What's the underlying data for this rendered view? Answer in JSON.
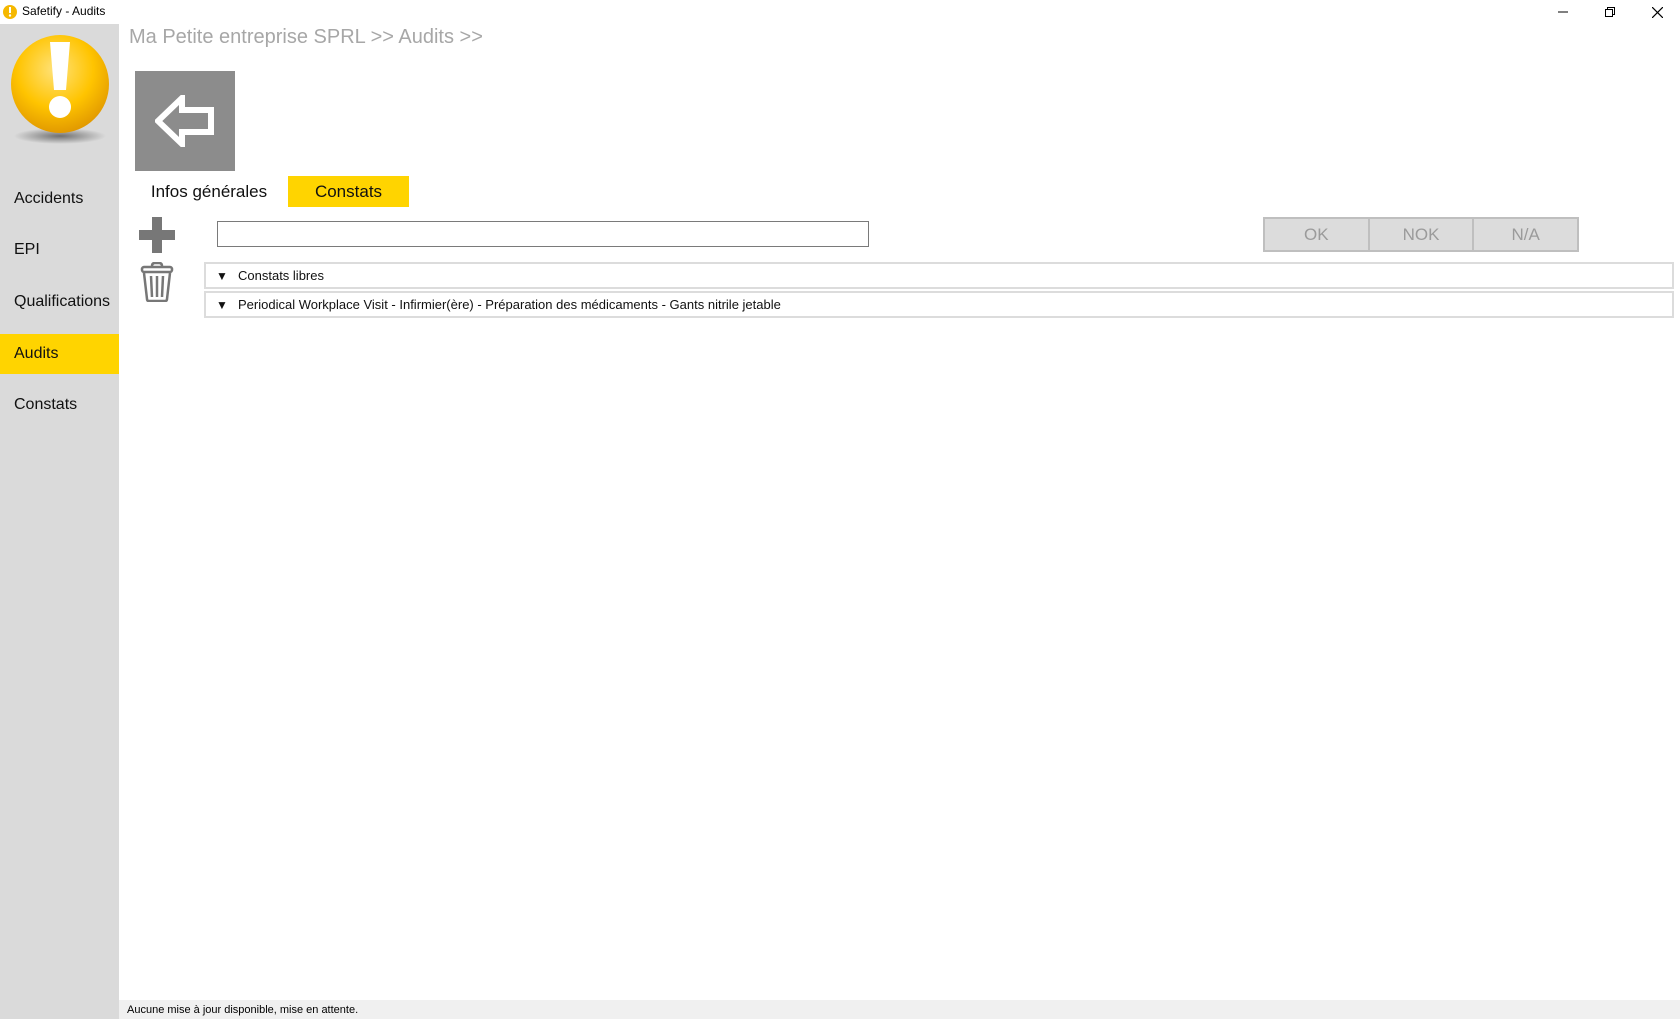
{
  "window": {
    "title": "Safetify - Audits"
  },
  "sidebar": {
    "items": [
      {
        "label": "Accidents",
        "active": false
      },
      {
        "label": "EPI",
        "active": false
      },
      {
        "label": "Qualifications",
        "active": false
      },
      {
        "label": "Audits",
        "active": true
      },
      {
        "label": "Constats",
        "active": false
      }
    ]
  },
  "breadcrumb": "Ma Petite entreprise SPRL >> Audits >>",
  "tabs": [
    {
      "label": "Infos générales",
      "active": false
    },
    {
      "label": "Constats",
      "active": true
    }
  ],
  "search": {
    "value": "",
    "placeholder": ""
  },
  "status_buttons": [
    "OK",
    "NOK",
    "N/A"
  ],
  "groups": [
    {
      "label": "Constats libres"
    },
    {
      "label": "Periodical Workplace Visit  - Infirmier(ère) - Préparation des médicaments  - Gants nitrile jetable"
    }
  ],
  "statusbar": "Aucune mise à jour disponible, mise en attente.",
  "colors": {
    "accent": "#ffd400",
    "sidebar": "#dadada",
    "back_button": "#8c8c8c"
  },
  "icons": {
    "app": "warning-icon",
    "back": "arrow-left-icon",
    "add": "plus-icon",
    "delete": "trash-icon",
    "expander": "triangle-down-icon"
  }
}
